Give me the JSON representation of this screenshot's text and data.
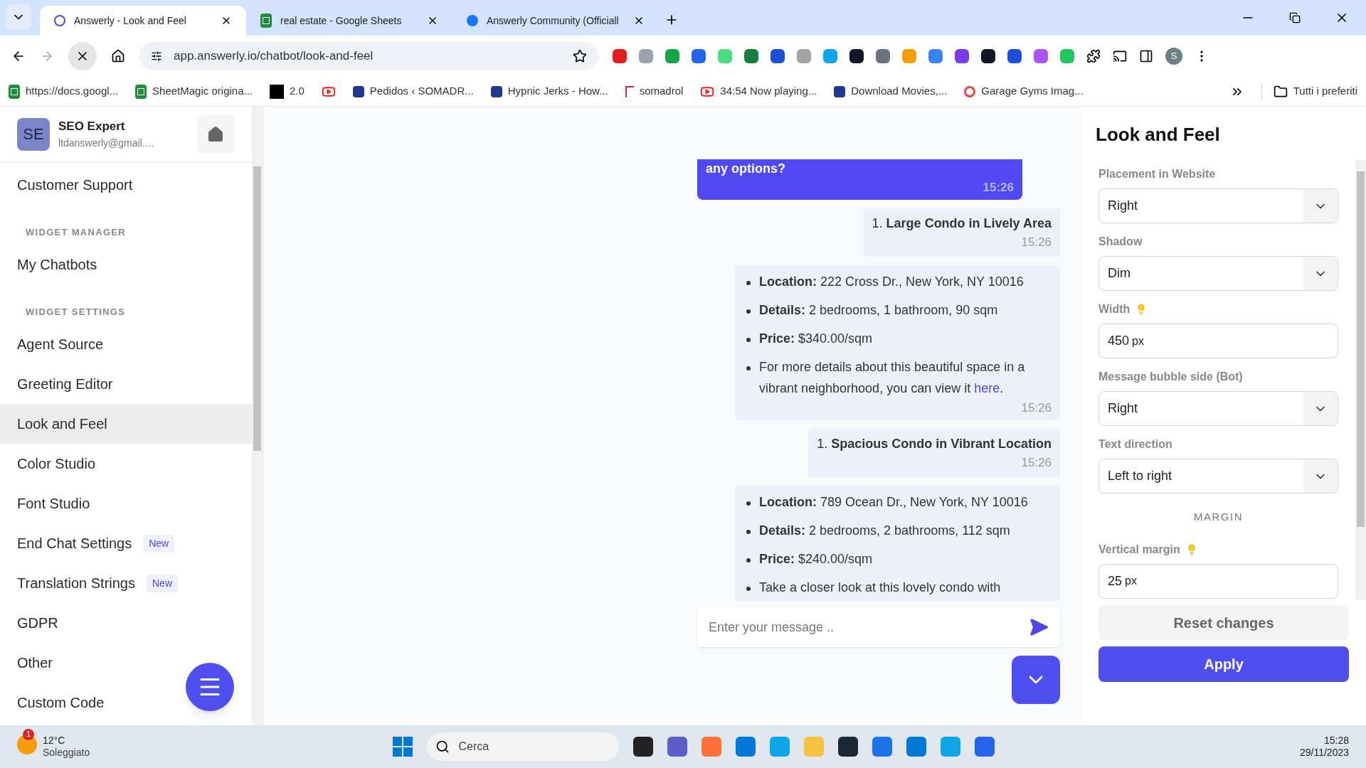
{
  "browser": {
    "tabs": [
      {
        "title": "Answerly - Look and Feel",
        "selected": true
      },
      {
        "title": "real estate - Google Sheets",
        "selected": false
      },
      {
        "title": "Answerly Community (Officiall",
        "selected": false
      }
    ],
    "url": "app.answerly.io/chatbot/look-and-feel",
    "profile_initial": "S",
    "bookmarks": [
      {
        "label": "https://docs.googl..."
      },
      {
        "label": "SheetMagic origina..."
      },
      {
        "label": "2.0"
      },
      {
        "kind": "icon_only"
      },
      {
        "label": "Pedidos ‹ SOMADR..."
      },
      {
        "label": "Hypnic Jerks - How..."
      },
      {
        "label": "somadrol"
      },
      {
        "label": "34:54 Now playing..."
      },
      {
        "label": "Download Movies,..."
      },
      {
        "label": "Garage Gyms Imag..."
      }
    ],
    "all_bookmarks": "Tutti i preferiti"
  },
  "sidebar": {
    "avatar": "SE",
    "name": "SEO Expert",
    "email": "ltdanswerly@gmail.…",
    "items": [
      {
        "kind": "item",
        "label": "Customer Support",
        "selected": false
      },
      {
        "kind": "heading",
        "label": "WIDGET MANAGER"
      },
      {
        "kind": "item",
        "label": "My Chatbots",
        "selected": false
      },
      {
        "kind": "heading",
        "label": "WIDGET SETTINGS"
      },
      {
        "kind": "item",
        "label": "Agent Source",
        "selected": false
      },
      {
        "kind": "item",
        "label": "Greeting Editor",
        "selected": false
      },
      {
        "kind": "item",
        "label": "Look and Feel",
        "selected": true
      },
      {
        "kind": "item",
        "label": "Color Studio",
        "selected": false
      },
      {
        "kind": "item",
        "label": "Font Studio",
        "selected": false
      },
      {
        "kind": "item",
        "label": "End Chat Settings",
        "selected": false,
        "badge": "New"
      },
      {
        "kind": "item",
        "label": "Translation Strings",
        "selected": false,
        "badge": "New"
      },
      {
        "kind": "item",
        "label": "GDPR",
        "selected": false
      },
      {
        "kind": "item",
        "label": "Other",
        "selected": false
      },
      {
        "kind": "item",
        "label": "Custom Code",
        "selected": false
      }
    ]
  },
  "chat": {
    "messages": [
      {
        "kind": "user",
        "text": "any options?",
        "time": "15:26"
      },
      {
        "kind": "title",
        "number": "1.",
        "text": "Large Condo in Lively Area",
        "time": "15:26"
      },
      {
        "kind": "details",
        "time": "15:26",
        "bullets": [
          {
            "text": "**Location:** 222 Cross Dr., New York, NY 10016"
          },
          {
            "text": "**Details:** 2 bedrooms, 1 bathroom, 90 sqm"
          },
          {
            "text": "**Price:** $340.00/sqm"
          },
          {
            "text": "For more details about this beautiful space in a vibrant neighborhood, you can view it ",
            "link": "here",
            "tail": "."
          }
        ]
      },
      {
        "kind": "title",
        "number": "1.",
        "text": "Spacious Condo in Vibrant Location",
        "time": "15:26"
      },
      {
        "kind": "details",
        "bullets": [
          {
            "text": "**Location:** 789 Ocean Dr., New York, NY 10016"
          },
          {
            "text": "**Details:** 2 bedrooms, 2 bathrooms, 112 sqm"
          },
          {
            "text": "**Price:** $240.00/sqm"
          },
          {
            "text": "Take a closer look at this lovely condo with"
          }
        ]
      }
    ],
    "placeholder": "Enter your message .."
  },
  "panel": {
    "title": "Look and Feel",
    "fields": [
      {
        "kind": "select",
        "label": "Placement in Website",
        "value": "Right"
      },
      {
        "kind": "select",
        "label": "Shadow",
        "value": "Dim"
      },
      {
        "kind": "input",
        "label": "Width",
        "hint": true,
        "value": "450",
        "unit": "px"
      },
      {
        "kind": "select",
        "label": "Message bubble side (Bot)",
        "value": "Right"
      },
      {
        "kind": "select",
        "label": "Text direction",
        "value": "Left to right"
      },
      {
        "kind": "section",
        "label": "MARGIN"
      },
      {
        "kind": "input",
        "label": "Vertical margin",
        "hint": true,
        "value": "25",
        "unit": "px"
      }
    ],
    "buttons": [
      {
        "kind": "secondary",
        "label": "Reset changes"
      },
      {
        "kind": "primary",
        "label": "Apply"
      }
    ]
  },
  "taskbar": {
    "weather_badge": "1",
    "temperature": "12°C",
    "weather": "Soleggiato",
    "search_placeholder": "Cerca",
    "time": "15:28",
    "date": "29/11/2023"
  }
}
